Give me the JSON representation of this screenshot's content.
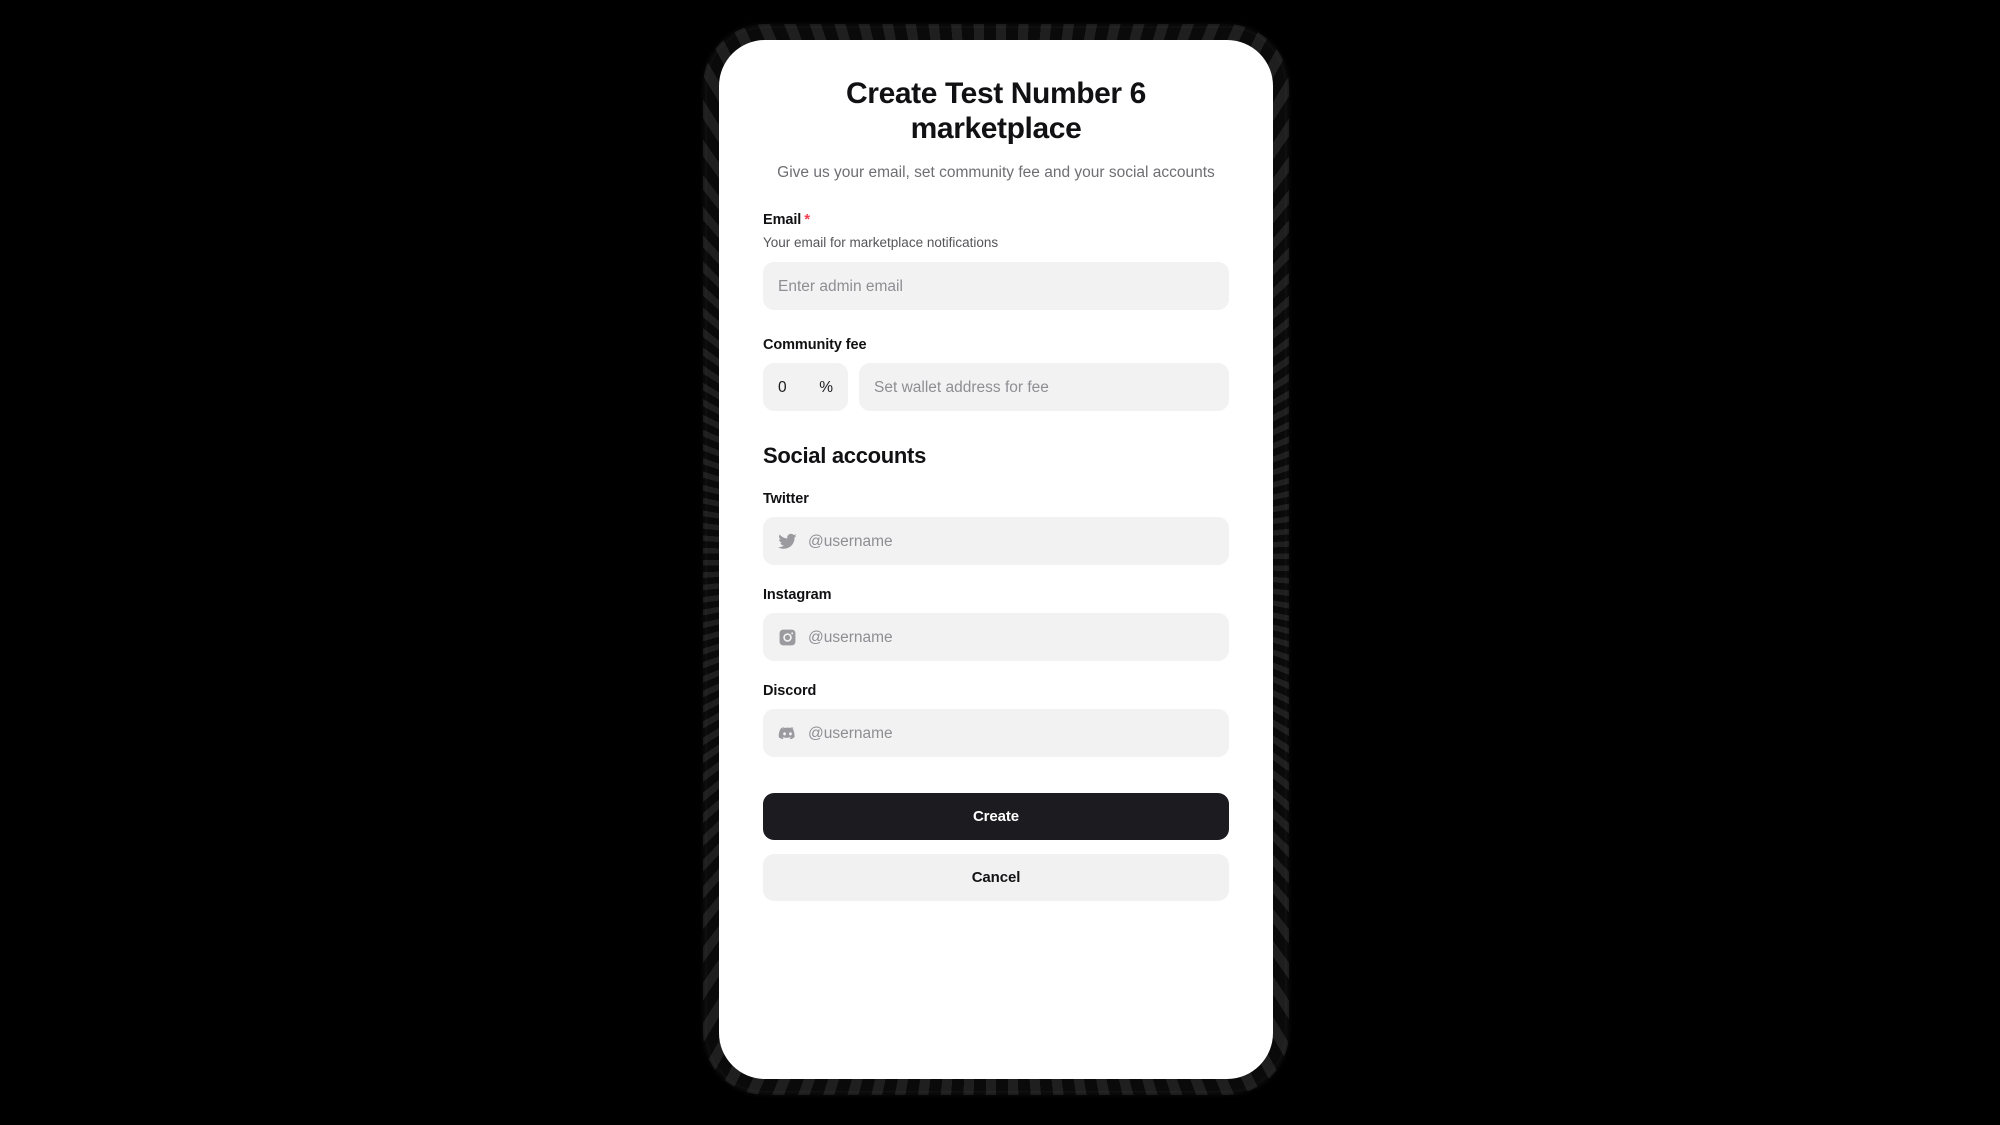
{
  "page": {
    "title": "Create Test Number 6 marketplace",
    "subtitle": "Give us your email, set community fee and your social accounts"
  },
  "email_field": {
    "label": "Email",
    "required_mark": "*",
    "hint": "Your email for marketplace notifications",
    "placeholder": "Enter admin email",
    "value": ""
  },
  "community_fee": {
    "label": "Community fee",
    "amount_value": "0",
    "amount_placeholder": "0",
    "percent_suffix": "%",
    "wallet_placeholder": "Set wallet address for fee",
    "wallet_value": ""
  },
  "social": {
    "heading": "Social accounts",
    "accounts": [
      {
        "label": "Twitter",
        "icon": "twitter-icon",
        "placeholder": "@username",
        "value": ""
      },
      {
        "label": "Instagram",
        "icon": "instagram-icon",
        "placeholder": "@username",
        "value": ""
      },
      {
        "label": "Discord",
        "icon": "discord-icon",
        "placeholder": "@username",
        "value": ""
      }
    ]
  },
  "actions": {
    "create_label": "Create",
    "cancel_label": "Cancel"
  },
  "colors": {
    "background": "#000000",
    "screen": "#ffffff",
    "input_background": "#f2f2f3",
    "placeholder_text": "#8e8e93",
    "primary_text": "#111113",
    "muted_text": "#6e6e73",
    "required_asterisk": "#ef4050",
    "primary_button": "#1c1c20",
    "secondary_button": "#f1f1f2",
    "social_icon": "#9a9a9f"
  }
}
